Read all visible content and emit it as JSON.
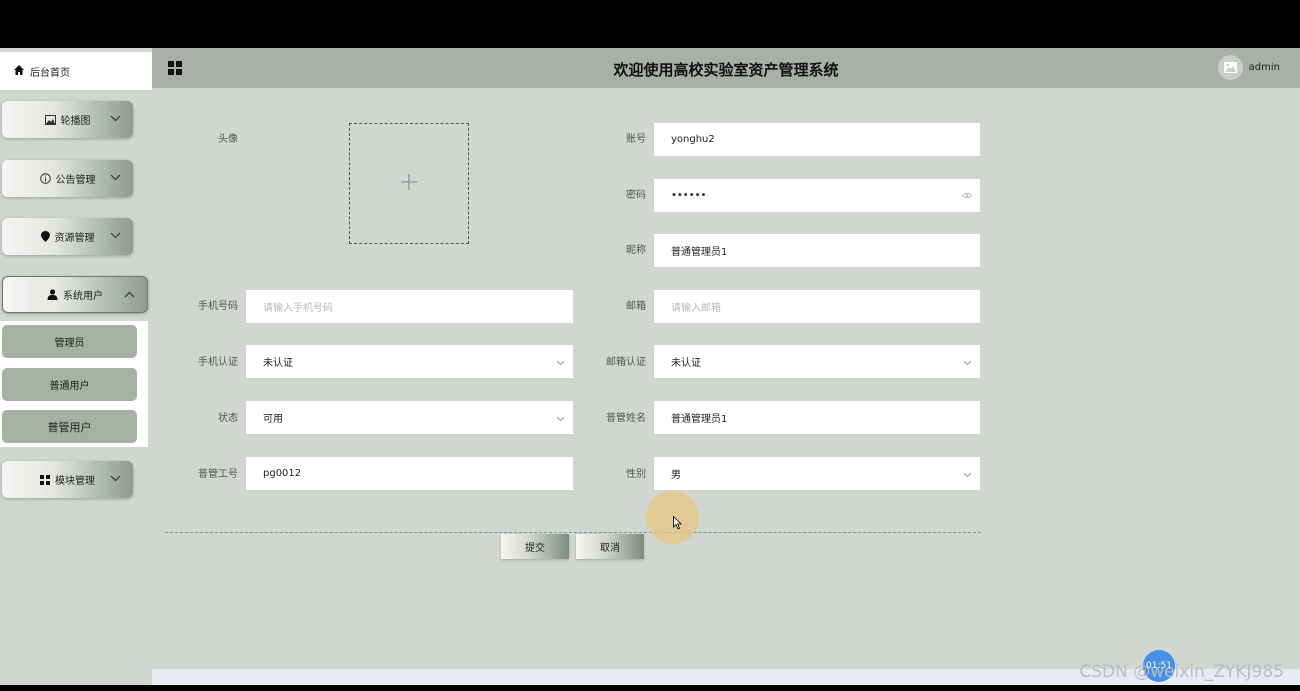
{
  "header": {
    "title": "欢迎使用高校实验室资产管理系统",
    "username": "admin"
  },
  "sidebar": {
    "home_label": "后台首页",
    "menus": [
      {
        "label": "轮播图",
        "icon": "image-icon"
      },
      {
        "label": "公告管理",
        "icon": "info-icon"
      },
      {
        "label": "资源管理",
        "icon": "location-icon"
      },
      {
        "label": "系统用户",
        "icon": "user-icon",
        "expanded": true
      },
      {
        "label": "模块管理",
        "icon": "grid-icon"
      }
    ],
    "submenu": [
      "管理员",
      "普通用户",
      "普管用户"
    ]
  },
  "form": {
    "avatar_label": "头像",
    "account": {
      "label": "账号",
      "value": "yonghu2"
    },
    "password": {
      "label": "密码",
      "value": "••••••"
    },
    "nickname": {
      "label": "昵称",
      "value": "普通管理员1"
    },
    "phone": {
      "label": "手机号码",
      "placeholder": "请输入手机号码"
    },
    "email": {
      "label": "邮箱",
      "placeholder": "请输入邮箱"
    },
    "phone_verify": {
      "label": "手机认证",
      "value": "未认证"
    },
    "email_verify": {
      "label": "邮箱认证",
      "value": "未认证"
    },
    "status": {
      "label": "状态",
      "value": "可用"
    },
    "manager_name": {
      "label": "普管姓名",
      "value": "普通管理员1"
    },
    "manager_id": {
      "label": "普管工号",
      "value": "pg0012"
    },
    "gender": {
      "label": "性别",
      "value": "男"
    },
    "submit_label": "提交",
    "cancel_label": "取消"
  },
  "overlay": {
    "watermark": "CSDN @weixin_ZYKJ985",
    "float_ball": "01:51"
  }
}
